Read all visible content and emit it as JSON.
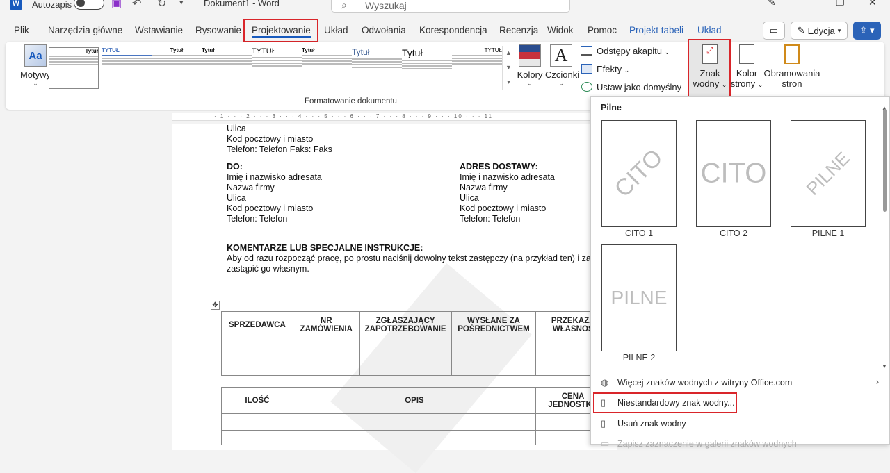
{
  "titlebar": {
    "app_logo": "W",
    "autosave_label": "Autozapis",
    "doc_title": "Dokument1 - Word",
    "search_placeholder": "Wyszukaj"
  },
  "tabs": [
    {
      "label": "Plik"
    },
    {
      "label": "Narzędzia główne"
    },
    {
      "label": "Wstawianie"
    },
    {
      "label": "Rysowanie"
    },
    {
      "label": "Projektowanie"
    },
    {
      "label": "Układ"
    },
    {
      "label": "Odwołania"
    },
    {
      "label": "Korespondencja"
    },
    {
      "label": "Recenzja"
    },
    {
      "label": "Widok"
    },
    {
      "label": "Pomoc"
    },
    {
      "label": "Projekt tabeli"
    },
    {
      "label": "Układ"
    }
  ],
  "right_buttons": {
    "edit_label": "Edycja"
  },
  "ribbon": {
    "themes_label": "Motywy",
    "gallery_titles": [
      "Tytuł",
      "TYTUŁ",
      "Tytuł",
      "Tytuł",
      "TYTUŁ",
      "Tytuł",
      "Tytuł",
      "Tytuł",
      "TYTUŁ"
    ],
    "group_label": "Formatowanie dokumentu",
    "colors_label": "Kolory",
    "fonts_label": "Czcionki",
    "paragraph_spacing": "Odstępy akapitu",
    "effects": "Efekty",
    "set_default": "Ustaw jako domyślny",
    "watermark_line1": "Znak",
    "watermark_line2": "wodny",
    "page_color_line1": "Kolor",
    "page_color_line2": "strony",
    "page_borders_line1": "Obramowania",
    "page_borders_line2": "stron"
  },
  "document": {
    "from_lines": [
      "Ulica",
      "Kod pocztowy i miasto",
      "Telefon: Telefon Faks: Faks"
    ],
    "to_heading": "DO:",
    "to_lines": [
      "Imię i nazwisko adresata",
      "Nazwa firmy",
      "Ulica",
      "Kod pocztowy i miasto",
      "Telefon: Telefon"
    ],
    "ship_heading": "ADRES DOSTAWY:",
    "ship_lines": [
      "Imię i nazwisko adresata",
      "Nazwa firmy",
      "Ulica",
      "Kod pocztowy i miasto",
      "Telefon: Telefon"
    ],
    "comments_heading": "KOMENTARZE LUB SPECJALNE INSTRUKCJE:",
    "comments_line1": "Aby od razu rozpocząć pracę, po prostu naciśnij dowolny tekst zastępczy (na przykład ten) i za",
    "comments_line2": "zastąpić go własnym.",
    "table1_headers": [
      "SPRZEDAWCA",
      "NR ZAMÓWIENIA",
      "ZGŁASZAJĄCY ZAPOTRZEBOWANIE",
      "WYSŁANE ZA POŚREDNICTWEM",
      "PRZEKAZA WŁASNOŚ"
    ],
    "table2_headers": [
      "ILOŚĆ",
      "OPIS",
      "CENA JEDNOSTKO"
    ]
  },
  "watermark_menu": {
    "section": "Pilne",
    "items": [
      {
        "label": "CITO 1",
        "text": "CITO"
      },
      {
        "label": "CITO 2",
        "text": "CITO"
      },
      {
        "label": "PILNE 1",
        "text": "PILNE"
      },
      {
        "label": "PILNE 2",
        "text": "PILNE"
      }
    ],
    "more_office": "Więcej znaków wodnych z witryny Office.com",
    "custom": "Niestandardowy znak wodny...",
    "remove": "Usuń znak wodny",
    "save_selection": "Zapisz zaznaczenie w galerii znaków wodnych"
  },
  "colors": {
    "accent": "#185abd",
    "highlight": "#d9252a"
  }
}
